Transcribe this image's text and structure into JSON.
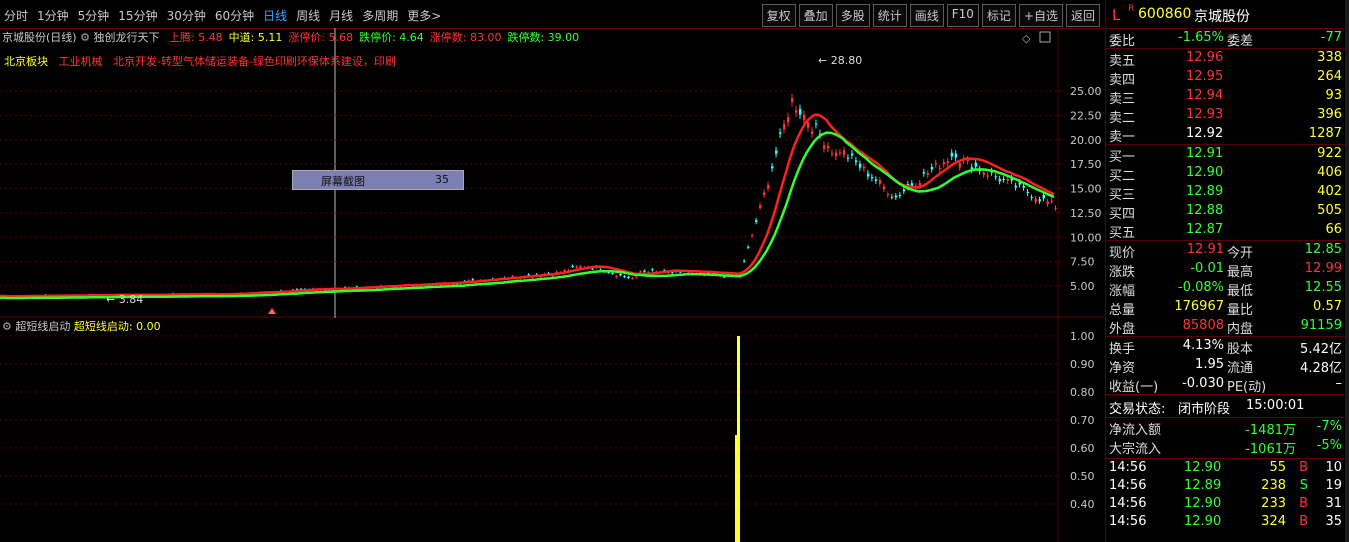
{
  "topbar": {
    "periods": [
      "分时",
      "1分钟",
      "5分钟",
      "15分钟",
      "30分钟",
      "60分钟",
      "日线",
      "周线",
      "月线",
      "多周期",
      "更多>"
    ],
    "active_period": "日线",
    "tools": [
      "复权",
      "叠加",
      "多股",
      "统计",
      "画线",
      "F10",
      "标记",
      "+自选",
      "返回"
    ]
  },
  "main": {
    "stock_name": "京城股份(日线)",
    "indicator_name": "独创龙行天下",
    "params": [
      {
        "label": "上腾:",
        "value": "5.48",
        "color": "#ff3333"
      },
      {
        "label": "中道:",
        "value": "5.11",
        "color": "#ffff33"
      },
      {
        "label": "涨停价:",
        "value": "5.68",
        "color": "#ff3333"
      },
      {
        "label": "跌停价:",
        "value": "4.64",
        "color": "#33ff33"
      },
      {
        "label": "涨停数:",
        "value": "83.00",
        "color": "#ff3333"
      },
      {
        "label": "跌停数:",
        "value": "39.00",
        "color": "#33ff33"
      }
    ],
    "sector_label": "北京板块",
    "industry": "工业机械",
    "concepts": "北京开发-转型气体储运装备-绿色印刷环保体系建设，印刷",
    "high_label": "28.80",
    "low_label": "3.84",
    "screenshot_tip": {
      "label": "屏幕截图",
      "number": "35"
    },
    "yaxis_labels": [
      "25.00",
      "22.50",
      "20.00",
      "17.50",
      "15.00",
      "12.50",
      "10.00",
      "7.50",
      "5.00"
    ]
  },
  "sub": {
    "indicator_name": "超短线启动",
    "value_label": "超短线启动: 0.00",
    "yaxis_labels": [
      "1.00",
      "0.90",
      "0.80",
      "0.70",
      "0.60",
      "0.50",
      "0.40"
    ]
  },
  "quote": {
    "flag": "L",
    "r_mark": "R",
    "code": "600860",
    "name": "京城股份",
    "weibi_label": "委比",
    "weibi": "-1.65%",
    "weicha_label": "委差",
    "weicha": "-77",
    "asks": [
      {
        "label": "卖五",
        "price": "12.96",
        "vol": "338"
      },
      {
        "label": "卖四",
        "price": "12.95",
        "vol": "264"
      },
      {
        "label": "卖三",
        "price": "12.94",
        "vol": "93"
      },
      {
        "label": "卖二",
        "price": "12.93",
        "vol": "396"
      },
      {
        "label": "卖一",
        "price": "12.92",
        "vol": "1287"
      }
    ],
    "bids": [
      {
        "label": "买一",
        "price": "12.91",
        "vol": "922"
      },
      {
        "label": "买二",
        "price": "12.90",
        "vol": "406"
      },
      {
        "label": "买三",
        "price": "12.89",
        "vol": "402"
      },
      {
        "label": "买四",
        "price": "12.88",
        "vol": "505"
      },
      {
        "label": "买五",
        "price": "12.87",
        "vol": "66"
      }
    ],
    "stats": [
      {
        "l1": "现价",
        "v1": "12.91",
        "c1": "r",
        "l2": "今开",
        "v2": "12.85",
        "c2": "g"
      },
      {
        "l1": "涨跌",
        "v1": "-0.01",
        "c1": "g",
        "l2": "最高",
        "v2": "12.99",
        "c2": "r"
      },
      {
        "l1": "涨幅",
        "v1": "-0.08%",
        "c1": "g",
        "l2": "最低",
        "v2": "12.55",
        "c2": "g"
      },
      {
        "l1": "总量",
        "v1": "176967",
        "c1": "y",
        "l2": "量比",
        "v2": "0.57",
        "c2": "y"
      },
      {
        "l1": "外盘",
        "v1": "85808",
        "c1": "r",
        "l2": "内盘",
        "v2": "91159",
        "c2": "g"
      }
    ],
    "fund": [
      {
        "l1": "换手",
        "v1": "4.13%",
        "l2": "股本",
        "v2": "5.42亿"
      },
      {
        "l1": "净资",
        "v1": "1.95",
        "l2": "流通",
        "v2": "4.28亿"
      },
      {
        "l1": "收益(一)",
        "v1": "-0.030",
        "l2": "PE(动)",
        "v2": "–"
      }
    ],
    "status_label": "交易状态:",
    "status": "闭市阶段",
    "status_time": "15:00:01",
    "flows": [
      {
        "label": "净流入额",
        "value": "-1481万",
        "pct": "-7%"
      },
      {
        "label": "大宗流入",
        "value": "-1061万",
        "pct": "-5%"
      }
    ],
    "ticks": [
      {
        "time": "14:56",
        "price": "12.90",
        "vol": "55",
        "side": "B",
        "num": "10"
      },
      {
        "time": "14:56",
        "price": "12.89",
        "vol": "238",
        "side": "S",
        "num": "19"
      },
      {
        "time": "14:56",
        "price": "12.90",
        "vol": "233",
        "side": "B",
        "num": "31"
      },
      {
        "time": "14:56",
        "price": "12.90",
        "vol": "324",
        "side": "B",
        "num": "35"
      }
    ]
  },
  "colors": {
    "up": "#ff3333",
    "down": "#33ff33",
    "neutral": "#ffff33",
    "grid": "#5a0000",
    "tip_bg": "#7d7fb2"
  }
}
